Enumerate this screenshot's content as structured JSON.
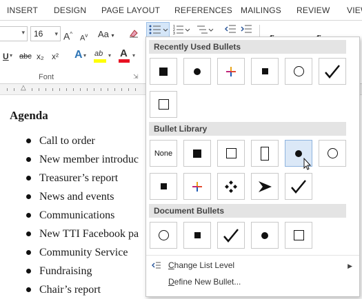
{
  "ribbon": {
    "tabs": [
      "INSERT",
      "DESIGN",
      "PAGE LAYOUT",
      "REFERENCES",
      "MAILINGS",
      "REVIEW",
      "VIEW"
    ],
    "font_size": "16",
    "group_label": "Font",
    "grow_font": "A",
    "shrink_font": "A",
    "change_case": "Aa",
    "underline": "U",
    "strikethrough": "abc",
    "subscript": "x₂",
    "superscript": "x²",
    "text_effects": "A",
    "highlight": "ab",
    "font_color": "A",
    "styles": [
      "¶ ",
      "¶ "
    ]
  },
  "document": {
    "heading": "Agenda",
    "items": [
      "Call to order",
      "New member introduc",
      "Treasurer’s report",
      "News and events",
      "Communications",
      "New TTI Facebook pa",
      "Community Service",
      "Fundraising",
      "Chair’s report"
    ]
  },
  "dropdown": {
    "recently_used_header": "Recently Used Bullets",
    "recently_used": [
      "filled-square",
      "filled-circle",
      "color-star",
      "small-filled-square",
      "hollow-circle",
      "checkmark",
      "hollow-square"
    ],
    "library_header": "Bullet Library",
    "none_label": "None",
    "library": [
      "none",
      "filled-square",
      "hollow-square",
      "hollow-rectangle",
      "filled-circle",
      "hollow-circle",
      "small-filled-square",
      "color-star",
      "diamond-cluster",
      "arrowhead",
      "checkmark"
    ],
    "hovered_item": "filled-circle",
    "document_header": "Document Bullets",
    "document_bullets": [
      "hollow-circle",
      "small-filled-square",
      "checkmark",
      "filled-circle",
      "hollow-square"
    ],
    "change_list_level_prefix": "C",
    "change_list_level_rest": "hange List Level",
    "define_new_bullet_prefix": "D",
    "define_new_bullet_rest": "efine New Bullet..."
  },
  "colors": {
    "hover_fill": "#dbe8f7",
    "hover_border": "#8eb3de",
    "section_header_bg": "#e4e4e4",
    "highlight_yellow": "#ffff00",
    "font_red": "#e81123"
  }
}
